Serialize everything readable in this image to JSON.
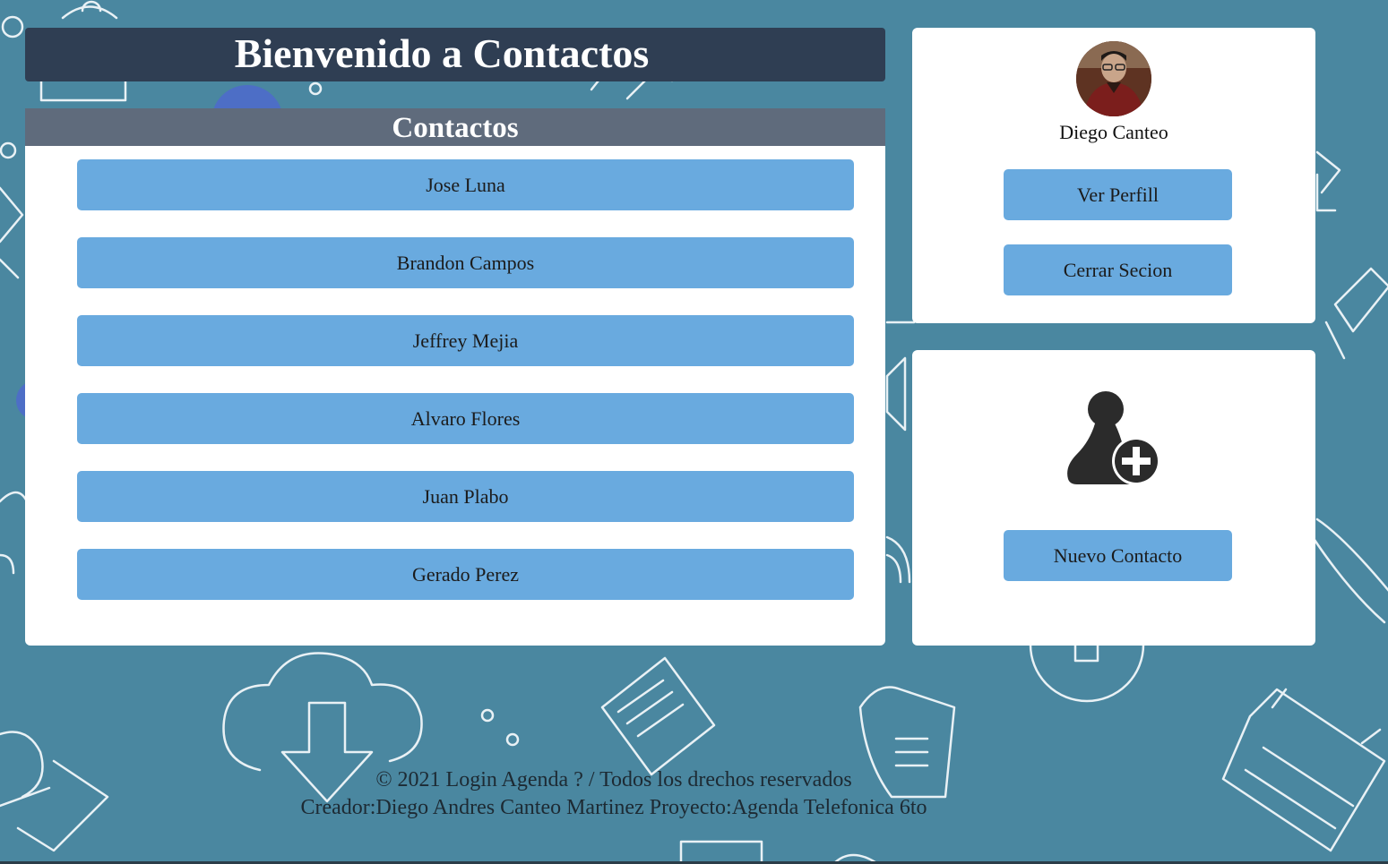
{
  "header": {
    "title": "Bienvenido a Contactos"
  },
  "contacts": {
    "heading": "Contactos",
    "items": [
      {
        "label": "Jose Luna"
      },
      {
        "label": "Brandon Campos"
      },
      {
        "label": "Jeffrey Mejia"
      },
      {
        "label": "Alvaro Flores"
      },
      {
        "label": "Juan Plabo"
      },
      {
        "label": "Gerado Perez"
      }
    ]
  },
  "profile": {
    "name": "Diego Canteo",
    "avatar_icon": "user-photo",
    "view_profile_label": "Ver Perfill",
    "logout_label": "Cerrar Secion"
  },
  "new_contact": {
    "icon": "add-user-icon",
    "button_label": "Nuevo Contacto"
  },
  "footer": {
    "line1": "© 2021 Login Agenda ? / Todos los drechos reservados",
    "line2": "Creador:Diego Andres Canteo Martinez Proyecto:Agenda Telefonica 6to"
  },
  "colors": {
    "background": "#4a87a0",
    "title_bar": "#2f3e53",
    "section_header": "#5f6b7c",
    "button": "#69aadf",
    "panel": "#ffffff"
  }
}
